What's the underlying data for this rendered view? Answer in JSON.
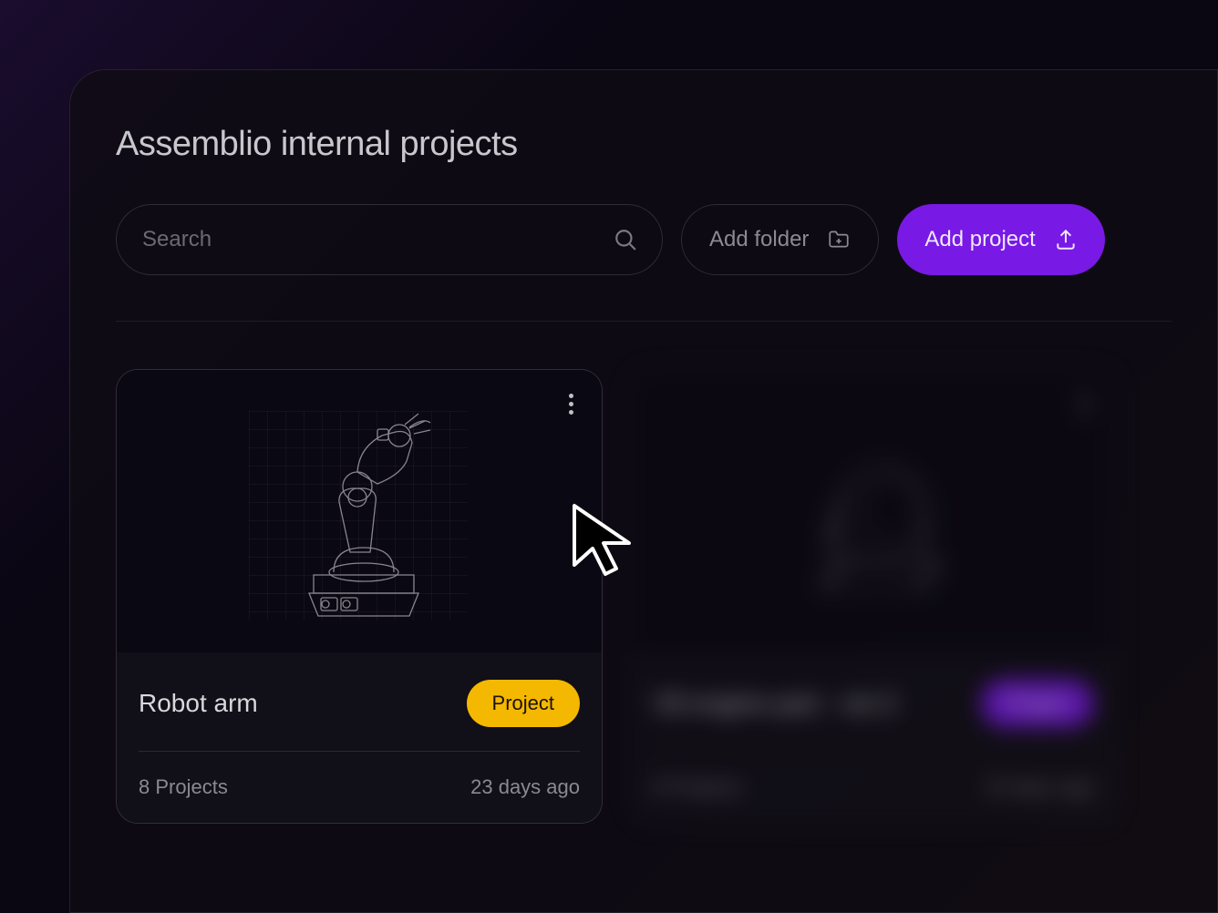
{
  "header": {
    "title": "Assemblio internal projects"
  },
  "toolbar": {
    "search_placeholder": "Search",
    "add_folder_label": "Add folder",
    "add_project_label": "Add project"
  },
  "cards": [
    {
      "title": "Robot arm",
      "badge": "Project",
      "badge_color": "yellow",
      "projects_count": "8 Projects",
      "time": "23 days ago"
    },
    {
      "title": "V8 engine part - ver.2",
      "badge": "Project",
      "badge_color": "purple",
      "projects_count": "8 Projects",
      "time": "23 days ago"
    }
  ],
  "colors": {
    "accent": "#7919e6",
    "badge_yellow": "#f5b800"
  }
}
